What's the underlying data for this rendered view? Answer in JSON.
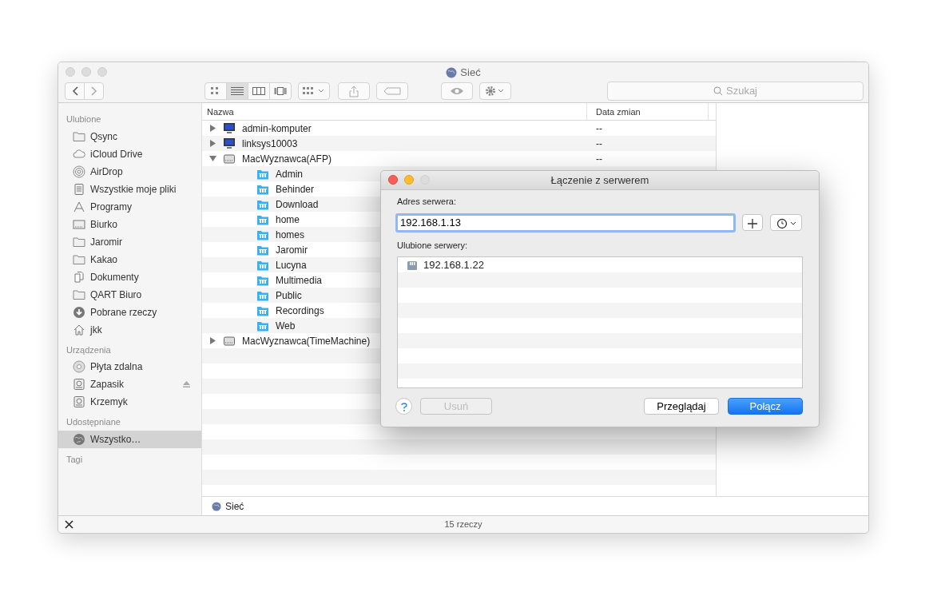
{
  "window": {
    "title": "Sieć"
  },
  "toolbar": {
    "view_modes": [
      {
        "kind": "icons",
        "selected": false
      },
      {
        "kind": "list",
        "selected": true
      },
      {
        "kind": "columns",
        "selected": false
      },
      {
        "kind": "coverflow",
        "selected": false
      }
    ],
    "search": {
      "placeholder": "Szukaj"
    }
  },
  "sidebar": {
    "sections": [
      {
        "title": "Ulubione",
        "items": [
          {
            "label": "Qsync",
            "kind": "folder",
            "selected": false
          },
          {
            "label": "iCloud Drive",
            "kind": "cloud",
            "selected": false
          },
          {
            "label": "AirDrop",
            "kind": "airdrop",
            "selected": false
          },
          {
            "label": "Wszystkie moje pliki",
            "kind": "files",
            "selected": false
          },
          {
            "label": "Programy",
            "kind": "apps",
            "selected": false
          },
          {
            "label": "Biurko",
            "kind": "desktop",
            "selected": false
          },
          {
            "label": "Jaromir",
            "kind": "folder",
            "selected": false
          },
          {
            "label": "Kakao",
            "kind": "folder",
            "selected": false
          },
          {
            "label": "Dokumenty",
            "kind": "documents",
            "selected": false
          },
          {
            "label": "QART Biuro",
            "kind": "folder",
            "selected": false
          },
          {
            "label": "Pobrane rzeczy",
            "kind": "download",
            "selected": false
          },
          {
            "label": "jkk",
            "kind": "home",
            "selected": false
          }
        ]
      },
      {
        "title": "Urządzenia",
        "items": [
          {
            "label": "Płyta zdalna",
            "kind": "disc",
            "selected": false
          },
          {
            "label": "Zapasik",
            "kind": "disk",
            "selected": false,
            "ejectable": true
          },
          {
            "label": "Krzemyk",
            "kind": "disk",
            "selected": false
          }
        ]
      },
      {
        "title": "Udostępniane",
        "items": [
          {
            "label": "Wszystko…",
            "kind": "network",
            "selected": true
          }
        ]
      },
      {
        "title": "Tagi"
      }
    ]
  },
  "file_list": {
    "columns": [
      "Nazwa",
      "Data zmian"
    ],
    "rows": [
      {
        "name": "admin-komputer",
        "kind": "computer",
        "expanded": false,
        "date": "--"
      },
      {
        "name": "linksys10003",
        "kind": "computer",
        "expanded": false,
        "date": "--"
      },
      {
        "name": "MacWyznawca(AFP)",
        "kind": "server",
        "expanded": true,
        "date": "--",
        "children": [
          {
            "name": "Admin",
            "kind": "share"
          },
          {
            "name": "Behinder",
            "kind": "share"
          },
          {
            "name": "Download",
            "kind": "share"
          },
          {
            "name": "home",
            "kind": "share"
          },
          {
            "name": "homes",
            "kind": "share"
          },
          {
            "name": "Jaromir",
            "kind": "share"
          },
          {
            "name": "Lucyna",
            "kind": "share"
          },
          {
            "name": "Multimedia",
            "kind": "share"
          },
          {
            "name": "Public",
            "kind": "share"
          },
          {
            "name": "Recordings",
            "kind": "share"
          },
          {
            "name": "Web",
            "kind": "share"
          }
        ]
      },
      {
        "name": "MacWyznawca(TimeMachine)",
        "kind": "server",
        "expanded": false
      }
    ]
  },
  "path_bar": {
    "label": "Sieć"
  },
  "status_bar": {
    "text": "15 rzeczy"
  },
  "dialog": {
    "title": "Łączenie z serwerem",
    "address_label": "Adres serwera:",
    "address_value": "192.168.1.13",
    "favorites_label": "Ulubione serwery:",
    "favorites": [
      {
        "label": "192.168.1.22",
        "selected": false
      }
    ],
    "buttons": [
      {
        "kind": "remove",
        "label": "Usuń",
        "disabled": true
      },
      {
        "kind": "browse",
        "label": "Przeglądaj",
        "disabled": false
      },
      {
        "kind": "connect",
        "label": "Połącz",
        "disabled": false
      }
    ]
  }
}
